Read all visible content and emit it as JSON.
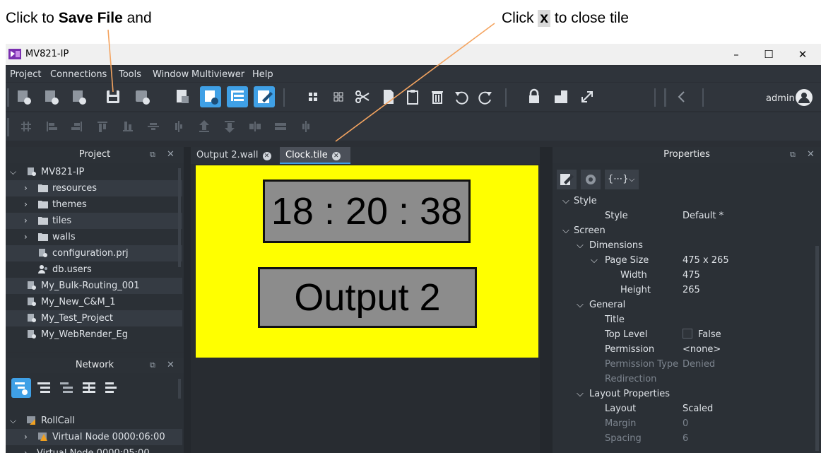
{
  "callouts": {
    "save": {
      "prefix": "Click to ",
      "bold": "Save File",
      "suffix": " and"
    },
    "close": {
      "prefix": "Click ",
      "bold": "x",
      "suffix": " to close tile"
    },
    "line_color": "#f4a460"
  },
  "window": {
    "title": "MV821-IP",
    "min": "–",
    "max": "☐",
    "close": "✕"
  },
  "menu": [
    "Project",
    "Connections",
    "Tools",
    "Window",
    "Multiviewer",
    "Help"
  ],
  "toolbar": {
    "user": "admin",
    "accent": "#3fa0e6"
  },
  "project_panel": {
    "title": "Project",
    "items": [
      {
        "label": "MV821-IP",
        "expanded": true
      },
      {
        "label": "resources"
      },
      {
        "label": "themes"
      },
      {
        "label": "tiles"
      },
      {
        "label": "walls"
      },
      {
        "label": "configuration.prj"
      },
      {
        "label": "db.users"
      },
      {
        "label": "My_Bulk-Routing_001"
      },
      {
        "label": "My_New_C&M_1"
      },
      {
        "label": "My_Test_Project"
      },
      {
        "label": "My_WebRender_Eg"
      }
    ]
  },
  "network_panel": {
    "title": "Network",
    "items": [
      {
        "label": "RollCall"
      },
      {
        "label": "Virtual Node 0000:06:00"
      },
      {
        "label": "Virtual Node 0000:05:00"
      }
    ]
  },
  "editor": {
    "tabs": [
      {
        "label": "Output 2.wall"
      },
      {
        "label": "Clock.tile"
      }
    ],
    "clock_text": "18 : 20 : 38",
    "output_text": "Output 2",
    "canvas_color": "#ffff00"
  },
  "properties": {
    "title": "Properties",
    "rows": [
      {
        "k": "Style",
        "v": ""
      },
      {
        "k": "Style",
        "v": "Default *"
      },
      {
        "k": "Screen",
        "v": ""
      },
      {
        "k": "Dimensions",
        "v": ""
      },
      {
        "k": "Page Size",
        "v": "475 x 265"
      },
      {
        "k": "Width",
        "v": "475"
      },
      {
        "k": "Height",
        "v": "265"
      },
      {
        "k": "General",
        "v": ""
      },
      {
        "k": "Title",
        "v": ""
      },
      {
        "k": "Top Level",
        "v": "False"
      },
      {
        "k": "Permission",
        "v": "<none>"
      },
      {
        "k": "Permission Type",
        "v": "Denied"
      },
      {
        "k": "Redirection",
        "v": ""
      },
      {
        "k": "Layout Properties",
        "v": ""
      },
      {
        "k": "Layout",
        "v": "Scaled"
      },
      {
        "k": "Margin",
        "v": "0"
      },
      {
        "k": "Spacing",
        "v": "6"
      }
    ]
  }
}
